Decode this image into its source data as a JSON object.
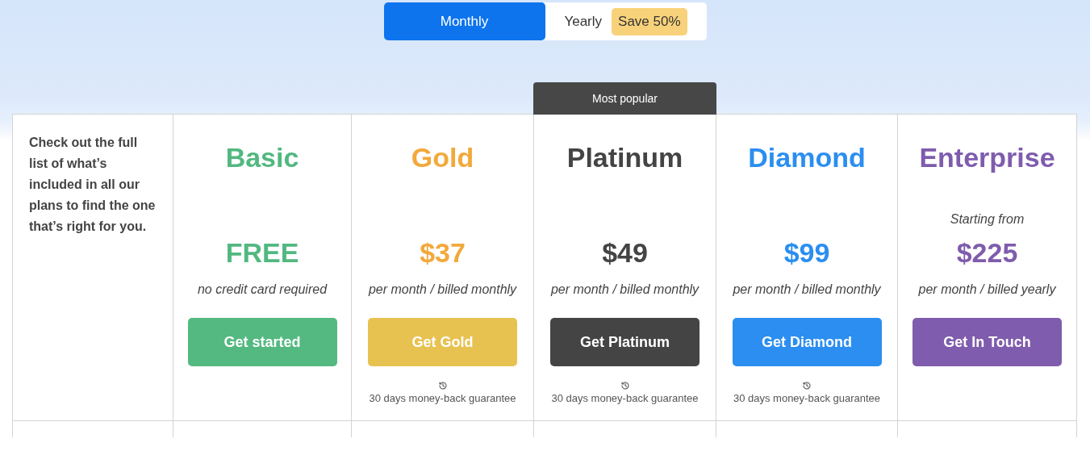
{
  "toggle": {
    "options": [
      {
        "label": "Monthly",
        "selected": true
      },
      {
        "label": "Yearly",
        "selected": false,
        "tag": "Save 50%"
      }
    ]
  },
  "intro": "Check out the full list of what’s included in all our plans to find the one that’s right for you.",
  "plans": [
    {
      "name": "Basic",
      "color": "#52b880",
      "price": "FREE",
      "period": "no credit card required",
      "button": {
        "label": "Get started",
        "color": "#54b981"
      }
    },
    {
      "name": "Gold",
      "color": "#f2a93b",
      "price": "$37",
      "period": "per month / billed monthly",
      "button": {
        "label": "Get Gold",
        "color": "#e8c251"
      },
      "guarantee": "30 days money-back guarantee"
    },
    {
      "name": "Platinum",
      "color": "#444444",
      "badge": "Most popular",
      "price": "$49",
      "period": "per month / billed monthly",
      "button": {
        "label": "Get Platinum",
        "color": "#444444"
      },
      "guarantee": "30 days money-back guarantee"
    },
    {
      "name": "Diamond",
      "color": "#2b8ef0",
      "price": "$99",
      "period": "per month / billed monthly",
      "button": {
        "label": "Get Diamond",
        "color": "#2b8ef0"
      },
      "guarantee": "30 days money-back guarantee"
    },
    {
      "name": "Enterprise",
      "color": "#7f5cad",
      "note": "Starting from",
      "price": "$225",
      "period": "per month / billed yearly",
      "button": {
        "label": "Get In Touch",
        "color": "#7f5cad"
      }
    }
  ]
}
